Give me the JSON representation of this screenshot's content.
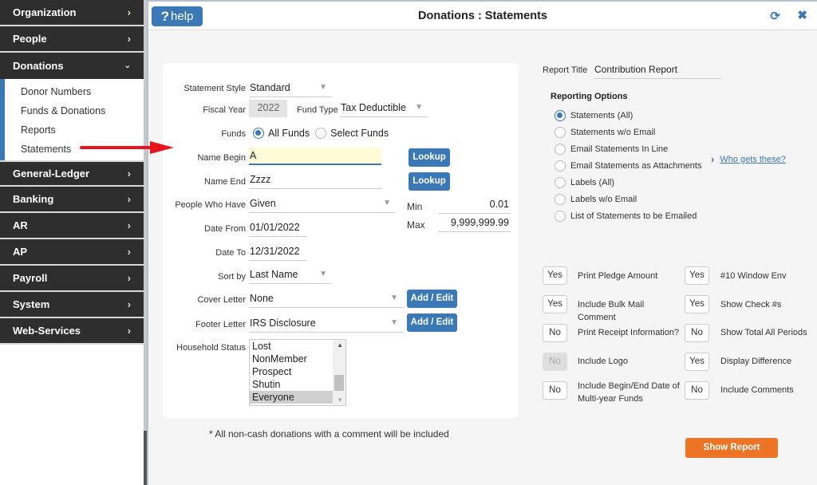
{
  "sidebar": {
    "items": [
      {
        "label": "Organization",
        "icon": "chevron-right-icon"
      },
      {
        "label": "People",
        "icon": "chevron-right-icon"
      },
      {
        "label": "Donations",
        "icon": "chevron-down-icon",
        "expanded": true,
        "children": [
          {
            "label": "Donor Numbers"
          },
          {
            "label": "Funds & Donations"
          },
          {
            "label": "Reports"
          },
          {
            "label": "Statements"
          }
        ]
      },
      {
        "label": "General-Ledger",
        "icon": "chevron-right-icon"
      },
      {
        "label": "Banking",
        "icon": "chevron-right-icon"
      },
      {
        "label": "AR",
        "icon": "chevron-right-icon"
      },
      {
        "label": "AP",
        "icon": "chevron-right-icon"
      },
      {
        "label": "Payroll",
        "icon": "chevron-right-icon"
      },
      {
        "label": "System",
        "icon": "chevron-right-icon"
      },
      {
        "label": "Web-Services",
        "icon": "chevron-right-icon"
      }
    ],
    "chevron_right": "›",
    "chevron_down": "⌄"
  },
  "window": {
    "help_q": "?",
    "help_label": "help",
    "title": "Donations : Statements",
    "refresh_icon": "⟳",
    "close_icon": "✖"
  },
  "form": {
    "statement_style": {
      "label": "Statement Style",
      "value": "Standard"
    },
    "fiscal_year": {
      "label": "Fiscal Year",
      "value": "2022"
    },
    "fund_type": {
      "label": "Fund Type",
      "value": "Tax Deductible"
    },
    "funds": {
      "label": "Funds",
      "options": [
        "All Funds",
        "Select Funds"
      ],
      "selected": "All Funds"
    },
    "name_begin": {
      "label": "Name Begin",
      "value": "A"
    },
    "name_end": {
      "label": "Name End",
      "value": "Zzzz"
    },
    "lookup_label": "Lookup",
    "people_who_have": {
      "label": "People Who Have",
      "value": "Given"
    },
    "min": {
      "label": "Min",
      "value": "0.01"
    },
    "max": {
      "label": "Max",
      "value": "9,999,999.99"
    },
    "date_from": {
      "label": "Date From",
      "value": "01/01/2022"
    },
    "date_to": {
      "label": "Date To",
      "value": "12/31/2022"
    },
    "sort_by": {
      "label": "Sort by",
      "value": "Last Name"
    },
    "cover_letter": {
      "label": "Cover Letter",
      "value": "None"
    },
    "footer_letter": {
      "label": "Footer Letter",
      "value": "IRS Disclosure"
    },
    "add_edit_label": "Add / Edit",
    "household_status": {
      "label": "Household Status",
      "options": [
        "Lost",
        "NonMember",
        "Prospect",
        "Shutin",
        "Everyone"
      ],
      "selected": "Everyone"
    },
    "dropdown_arrow": "▼",
    "note": "* All non-cash donations with a comment will be included"
  },
  "report": {
    "title_label": "Report Title",
    "title_value": "Contribution Report",
    "options_heading": "Reporting Options",
    "options": [
      "Statements (All)",
      "Statements w/o Email",
      "Email Statements In Line",
      "Email Statements as Attachments",
      "Labels (All)",
      "Labels w/o Email",
      "List of Statements to be Emailed"
    ],
    "selected_option": "Statements (All)",
    "who_gets_link": "Who gets these?",
    "toggles_left": [
      {
        "value": "Yes",
        "label": "Print Pledge Amount"
      },
      {
        "value": "Yes",
        "label": "Include Bulk Mail Comment"
      },
      {
        "value": "No",
        "label": "Print Receipt Information?"
      },
      {
        "value": "No",
        "label": "Include Logo",
        "disabled": true
      },
      {
        "value": "No",
        "label": "Include Begin/End Date of Multi-year Funds"
      }
    ],
    "toggles_right": [
      {
        "value": "Yes",
        "label": "#10 Window Env"
      },
      {
        "value": "Yes",
        "label": "Show Check #s"
      },
      {
        "value": "No",
        "label": "Show Total All Periods"
      },
      {
        "value": "Yes",
        "label": "Display Difference"
      },
      {
        "value": "No",
        "label": "Include Comments"
      }
    ],
    "show_report_label": "Show Report"
  },
  "colors": {
    "accent_blue": "#3a78b6",
    "sidebar_dark": "#2e2e2e",
    "show_report_orange": "#ee7425",
    "highlight_input": "#fefbd6",
    "annotation_arrow": "#e8141b"
  }
}
